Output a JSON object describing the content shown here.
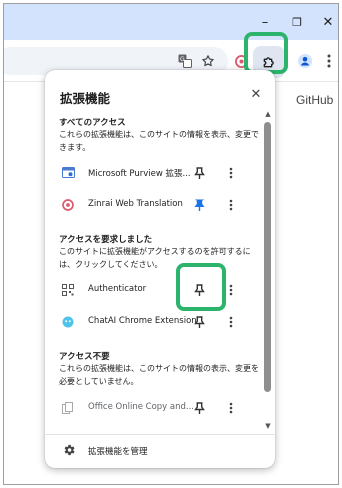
{
  "window": {
    "minimize_glyph": "–",
    "restore_glyph": "❐",
    "close_glyph": "✕"
  },
  "toolbar": {
    "translate_icon": "translate-icon",
    "bookmark_icon": "star-icon",
    "extension_icon": "puzzle-icon",
    "profile_icon": "profile-icon",
    "menu_icon": "kebab-menu-icon"
  },
  "page": {
    "github_link": "GitHub"
  },
  "popup": {
    "title": "拡張機能",
    "close_glyph": "✕",
    "sections": [
      {
        "title": "すべてのアクセス",
        "description": "これらの拡張機能は、このサイトの情報を表示、変更できます。",
        "items": [
          {
            "name": "Microsoft Purview 拡張...",
            "pinned": false
          },
          {
            "name": "Zinrai Web Translation",
            "pinned": true
          }
        ]
      },
      {
        "title": "アクセスを要求しました",
        "description": "このサイトに拡張機能がアクセスするのを許可するには、クリックしてください。",
        "items": [
          {
            "name": "Authenticator",
            "pinned": false
          },
          {
            "name": "ChatAI Chrome Extension",
            "pinned": false
          }
        ]
      },
      {
        "title": "アクセス不要",
        "description": "これらの拡張機能は、このサイトの情報の表示、変更を必要としていません。",
        "items": [
          {
            "name": "Office Online Copy and...",
            "pinned": false
          }
        ]
      }
    ],
    "footer": "拡張機能を管理"
  },
  "colors": {
    "highlight": "#2cb46c",
    "pinned": "#1a73e8",
    "titlebar": "#d3e3fd"
  }
}
